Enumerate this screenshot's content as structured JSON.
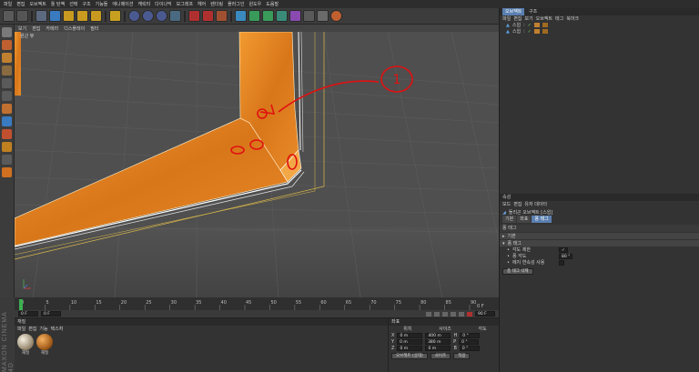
{
  "menubar": {
    "items": [
      "파일",
      "편집",
      "오브젝트",
      "툴 탄젝",
      "선택",
      "구조",
      "기능들",
      "애니메이션",
      "캐릭터",
      "다이나믹",
      "모그래프",
      "헤어",
      "렌더링",
      "플러그인",
      "윈도우",
      "도움말"
    ]
  },
  "viewport": {
    "menu": [
      "보기",
      "편집",
      "카메라",
      "디스플레이",
      "필터"
    ],
    "camera_label": "원근 뷰",
    "annotation_label": "1"
  },
  "timeline": {
    "ticks": [
      "0",
      "5",
      "10",
      "15",
      "20",
      "25",
      "30",
      "35",
      "40",
      "45",
      "50",
      "55",
      "60",
      "65",
      "70",
      "75",
      "80",
      "85",
      "90"
    ],
    "end_frame": "0 F",
    "start_field": "0 F",
    "current_field": "0 F",
    "end_field": "90 F"
  },
  "materials": {
    "title": "재질",
    "menu": [
      "파일",
      "편집",
      "기능",
      "텍스처"
    ],
    "items": [
      {
        "name": "재질",
        "color1": "#e8e0d0",
        "color2": "#8a7a60"
      },
      {
        "name": "재질",
        "color1": "#f0a050",
        "color2": "#6a3a10"
      }
    ]
  },
  "coordinates": {
    "title": "좌표",
    "headers": [
      "위치",
      "사이즈",
      "각도"
    ],
    "rows": [
      {
        "axis": "X",
        "pos": "0 m",
        "size": "400 m",
        "rot_axis": "H",
        "rot": "0 °"
      },
      {
        "axis": "Y",
        "pos": "0 m",
        "size": "380 m",
        "rot_axis": "P",
        "rot": "0 °"
      },
      {
        "axis": "Z",
        "pos": "0 m",
        "size": "0 m",
        "rot_axis": "B",
        "rot": "0 °"
      }
    ],
    "mode_select": "오브젝트 (상대)",
    "size_select": "사이즈",
    "apply_button": "적용"
  },
  "objects_panel": {
    "tabs": [
      "오브젝트",
      "구조"
    ],
    "menu": [
      "파일",
      "편집",
      "보기",
      "오브젝트",
      "태그",
      "북마크"
    ],
    "items": [
      {
        "name": "스윕"
      },
      {
        "name": "스윕"
      }
    ]
  },
  "attributes_panel": {
    "title": "속성",
    "menu": [
      "모드",
      "편집",
      "유저 데이터"
    ],
    "object_label": "돌리곤 오브젝트 [스윕]",
    "tabs": [
      "기본",
      "좌표",
      "퐁 태그"
    ],
    "section_title": "퐁 태그",
    "subsection_basic": "기본",
    "subsection_phong": "퐁 태그",
    "props": [
      {
        "label": "각도 제한",
        "value": "✓"
      },
      {
        "label": "퐁 각도",
        "value": "80 °"
      },
      {
        "label": "에지 연속성 사용",
        "value": ""
      }
    ],
    "action_button": "퐁 태그 삭제"
  },
  "branding": {
    "logo": "MAXON CINEMA 4D"
  },
  "colors": {
    "accent": "#5a7fb0",
    "wood": "#e2821f",
    "annotation": "#e01010"
  }
}
